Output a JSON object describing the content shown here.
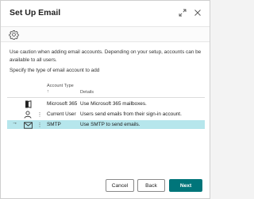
{
  "dialog": {
    "title": "Set Up Email",
    "caution_text": "Use caution when adding email accounts. Depending on your setup, accounts can be available to all users.",
    "specify_text": "Specify the type of email account to add"
  },
  "icons": {
    "expand": "expand-icon",
    "close": "close-icon",
    "settings": "gear-icon"
  },
  "table": {
    "columns": {
      "account_type": "Account Type ↑",
      "details": "Details"
    },
    "rows": [
      {
        "icon": "microsoft365-icon",
        "account_type": "Microsoft 365",
        "details": "Use Microsoft 365 mailboxes."
      },
      {
        "icon": "person-icon",
        "account_type": "Current User",
        "details": "Users send emails from their sign-in account."
      },
      {
        "icon": "envelope-icon",
        "account_type": "SMTP",
        "details": "Use SMTP to send emails.",
        "selected": true
      }
    ]
  },
  "buttons": {
    "cancel": "Cancel",
    "back": "Back",
    "next": "Next"
  },
  "colors": {
    "accent": "#00757a",
    "selected_row": "#b6e6ec"
  }
}
